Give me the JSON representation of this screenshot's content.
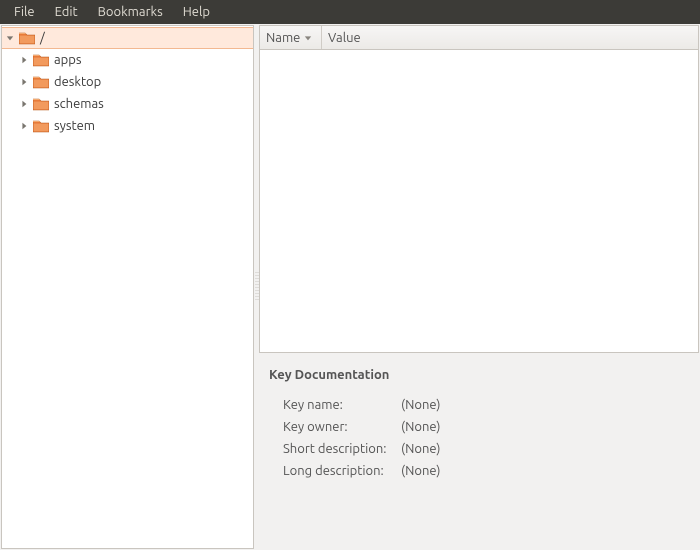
{
  "menubar": {
    "file": "File",
    "edit": "Edit",
    "bookmarks": "Bookmarks",
    "help": "Help"
  },
  "tree": {
    "root": "/",
    "items": [
      {
        "label": "apps"
      },
      {
        "label": "desktop"
      },
      {
        "label": "schemas"
      },
      {
        "label": "system"
      }
    ]
  },
  "columns": {
    "name": "Name",
    "value": "Value"
  },
  "doc": {
    "title": "Key Documentation",
    "key_name_label": "Key name:",
    "key_name_value": "(None)",
    "key_owner_label": "Key owner:",
    "key_owner_value": "(None)",
    "short_desc_label": "Short description:",
    "short_desc_value": "(None)",
    "long_desc_label": "Long description:",
    "long_desc_value": "(None)"
  }
}
